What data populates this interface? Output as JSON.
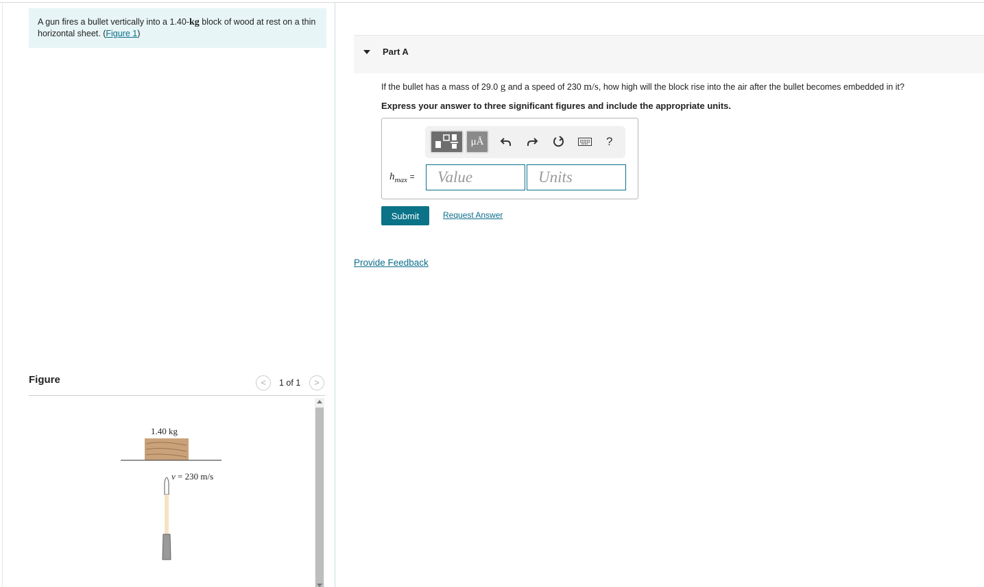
{
  "problem": {
    "text_before": "A gun fires a bullet vertically into a 1.40-",
    "mass_unit": "kg",
    "text_after": " block of wood at rest on a thin horizontal sheet. (",
    "figure_link": "Figure 1",
    "text_close": ")"
  },
  "figure_panel": {
    "title": "Figure",
    "counter": "1 of 1",
    "prev_glyph": "<",
    "next_glyph": ">",
    "block_label": "1.40 kg",
    "speed_symbol": "v",
    "speed_text": " = 230 m/s",
    "colors": {
      "wood": "#c9a27a",
      "wood_grain": "#9b7450",
      "barrel": "#9a9a9a",
      "trail": "#f5e3c4"
    }
  },
  "part": {
    "title": "Part A",
    "question_a": "If the bullet has a mass of 29.0 ",
    "question_unit_g": "g",
    "question_b": " and a speed of 230 ",
    "question_unit_ms": "m/s",
    "question_c": ", how high will the block rise into the air after the bullet becomes embedded in it?",
    "instruction": "Express your answer to three significant figures and include the appropriate units.",
    "toolbar": {
      "template_icon": "templates-icon",
      "units_label": "μÅ",
      "undo_icon": "undo-icon",
      "redo_icon": "redo-icon",
      "reset_icon": "reset-icon",
      "keyboard_icon": "keyboard-icon",
      "help_label": "?"
    },
    "variable": "h",
    "variable_sub": "max",
    "equals": "=",
    "value_placeholder": "Value",
    "units_placeholder": "Units",
    "submit_label": "Submit",
    "request_answer": "Request Answer"
  },
  "feedback_link": "Provide Feedback",
  "accent_color": "#0b7388"
}
